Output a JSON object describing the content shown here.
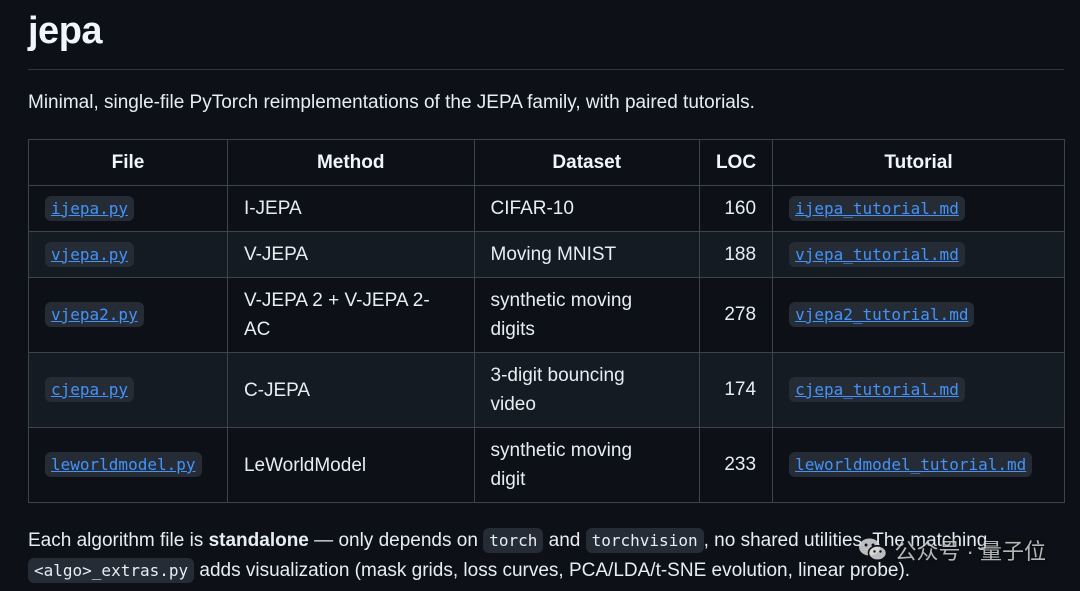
{
  "title": "jepa",
  "description": "Minimal, single-file PyTorch reimplementations of the JEPA family, with paired tutorials.",
  "table": {
    "headers": [
      "File",
      "Method",
      "Dataset",
      "LOC",
      "Tutorial"
    ],
    "rows": [
      {
        "file": "ijepa.py",
        "method": "I-JEPA",
        "dataset": "CIFAR-10",
        "loc": "160",
        "tutorial": "ijepa_tutorial.md"
      },
      {
        "file": "vjepa.py",
        "method": "V-JEPA",
        "dataset": "Moving MNIST",
        "loc": "188",
        "tutorial": "vjepa_tutorial.md"
      },
      {
        "file": "vjepa2.py",
        "method_lines": [
          "V-JEPA 2 + V-JEPA 2-",
          "AC"
        ],
        "dataset_lines": [
          "synthetic moving",
          "digits"
        ],
        "loc": "278",
        "tutorial": "vjepa2_tutorial.md"
      },
      {
        "file": "cjepa.py",
        "method": "C-JEPA",
        "dataset_lines": [
          "3-digit bouncing",
          "video"
        ],
        "loc": "174",
        "tutorial": "cjepa_tutorial.md"
      },
      {
        "file": "leworldmodel.py",
        "method": "LeWorldModel",
        "dataset_lines": [
          "synthetic moving",
          "digit"
        ],
        "loc": "233",
        "tutorial": "leworldmodel_tutorial.md"
      }
    ]
  },
  "footer": {
    "part1": "Each algorithm file is ",
    "bold": "standalone",
    "part2": " — only depends on ",
    "code1": "torch",
    "part3": " and ",
    "code2": "torchvision",
    "part4": ", no shared utilities. The matching ",
    "code3": "<algo>_extras.py",
    "part5": " adds visualization (mask grids, loss curves, PCA/LDA/t-SNE evolution, linear probe)."
  },
  "watermark": {
    "icon": "wechat-icon",
    "text": "公众号 · 量子位"
  }
}
